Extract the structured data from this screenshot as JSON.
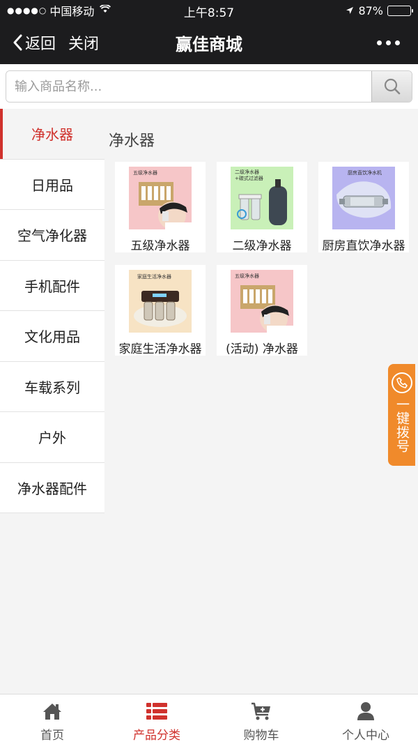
{
  "status_bar": {
    "signal_dots": "●●●●○",
    "carrier": "中国移动",
    "time": "上午8:57",
    "battery": "87%",
    "battery_level": 0.87
  },
  "nav": {
    "back_label": "返回",
    "close_label": "关闭",
    "title": "赢佳商城"
  },
  "search": {
    "placeholder": "输入商品名称...",
    "value": ""
  },
  "sidebar": {
    "items": [
      {
        "label": "净水器",
        "active": true
      },
      {
        "label": "日用品"
      },
      {
        "label": "空气净化器"
      },
      {
        "label": "手机配件"
      },
      {
        "label": "文化用品"
      },
      {
        "label": "车载系列"
      },
      {
        "label": "户外"
      },
      {
        "label": "净水器配件"
      }
    ]
  },
  "main": {
    "section_title": "净水器",
    "products": [
      {
        "name": "五级净水器",
        "thumb_caption": "五级净水器"
      },
      {
        "name": "二级净水器",
        "thumb_caption": "二级净水器",
        "thumb_caption2": "+碳式过滤器"
      },
      {
        "name": "厨房直饮净水器",
        "thumb_caption": "厨房直饮净水机"
      },
      {
        "name": "家庭生活净水器",
        "thumb_caption": "家庭生活净水器"
      },
      {
        "name": "(活动) 净水器",
        "thumb_caption": "五级净水器"
      }
    ]
  },
  "float_button": {
    "label": "一键拨号"
  },
  "tabbar": {
    "tabs": [
      {
        "label": "首页",
        "icon": "home-icon"
      },
      {
        "label": "产品分类",
        "icon": "list-icon",
        "active": true
      },
      {
        "label": "购物车",
        "icon": "cart-icon"
      },
      {
        "label": "个人中心",
        "icon": "user-icon"
      }
    ]
  },
  "colors": {
    "accent": "#d0322d",
    "nav_bg": "#1c1c1e",
    "float_bg": "#f08a2b"
  }
}
